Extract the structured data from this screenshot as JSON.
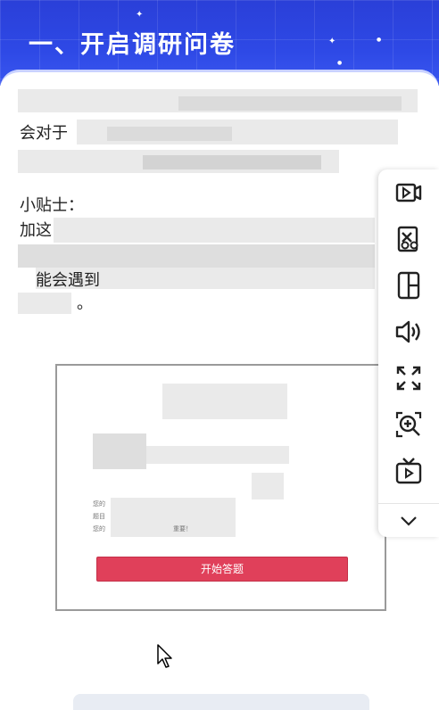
{
  "header": {
    "title": "一、开启调研问卷"
  },
  "content": {
    "line1_visible": "会对于",
    "tips_title": "小贴士：",
    "line_tip1_visible": "加这",
    "line_tip3_visible": "能会遇到",
    "line_tip4_visible": "。"
  },
  "toolbar": {
    "items": [
      {
        "icon": "video-play-icon"
      },
      {
        "icon": "video-edit-icon"
      },
      {
        "icon": "screen-rotate-icon"
      },
      {
        "icon": "volume-icon"
      },
      {
        "icon": "fullscreen-icon"
      },
      {
        "icon": "zoom-in-icon"
      },
      {
        "icon": "tv-play-icon"
      }
    ],
    "more_icon": "chevron-down-icon"
  },
  "preview": {
    "start_button": "开始答题",
    "text1": "您的",
    "text2": "题目",
    "text3": "您的",
    "text4": "重要！"
  },
  "colors": {
    "banner": "#2e49e6",
    "start_button": "#e0405a"
  }
}
